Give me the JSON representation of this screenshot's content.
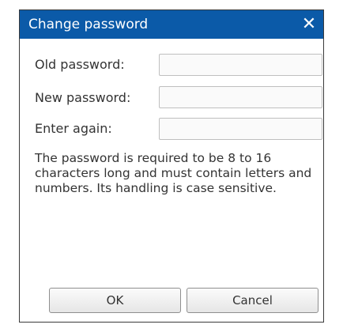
{
  "dialog": {
    "title": "Change password",
    "close_icon": "close-icon",
    "close_glyph": "✕",
    "fields": [
      {
        "label": "Old password:",
        "value": "",
        "placeholder": ""
      },
      {
        "label": "New password:",
        "value": "",
        "placeholder": ""
      },
      {
        "label": "Enter again:",
        "value": "",
        "placeholder": ""
      }
    ],
    "help_text": "The password is required to be 8 to 16 characters long and must contain letters and numbers. Its handling is case sensitive.",
    "ok_label": "OK",
    "cancel_label": "Cancel"
  },
  "colors": {
    "title_bar": "#0B5AA8",
    "title_text": "#FFFFFF",
    "body_text": "#333333",
    "field_border": "#BFBFBF",
    "button_border": "#8F8F8F"
  }
}
